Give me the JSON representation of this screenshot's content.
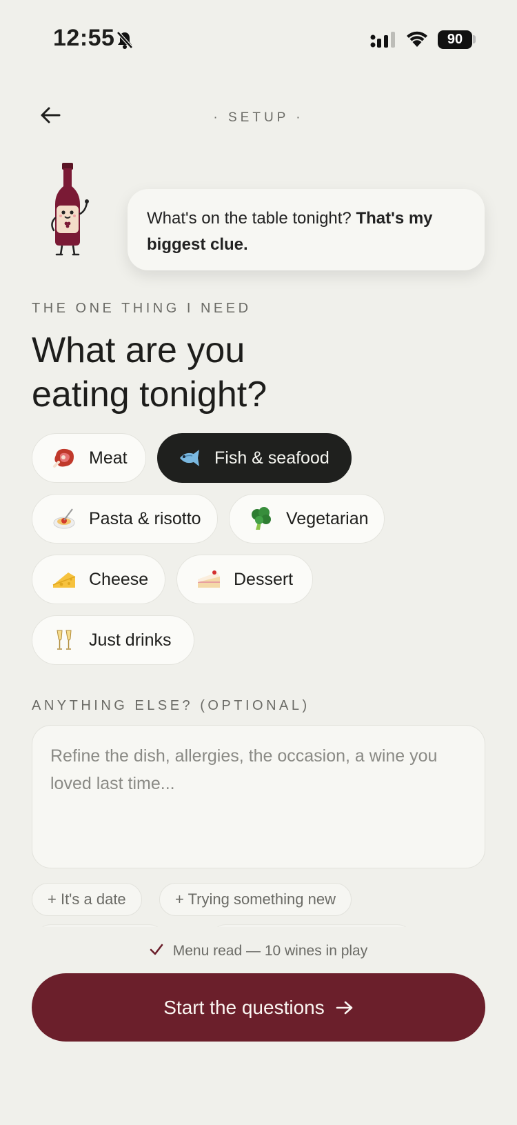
{
  "status_bar": {
    "time": "12:55",
    "battery": "90",
    "icons": [
      "bell-slash-icon",
      "signal-icon",
      "wifi-icon",
      "battery-icon"
    ]
  },
  "header": {
    "back_icon": "arrow-left-icon",
    "title": "· SETUP ·"
  },
  "mascot": {
    "icon": "wine-bottle-mascot",
    "bubble_text": "What's on the table tonight?",
    "bubble_bold": "That's my biggest clue."
  },
  "question": {
    "eyebrow": "THE ONE THING I NEED",
    "line1": "What are you",
    "line2": "eating tonight?"
  },
  "food_options": [
    {
      "label": "Meat",
      "icon": "steak-emoji",
      "selected": false
    },
    {
      "label": "Fish & seafood",
      "icon": "fish-emoji",
      "selected": true
    },
    {
      "label": "Pasta & risotto",
      "icon": "spaghetti-emoji",
      "selected": false
    },
    {
      "label": "Vegetarian",
      "icon": "broccoli-emoji",
      "selected": false
    },
    {
      "label": "Cheese",
      "icon": "cheese-emoji",
      "selected": false
    },
    {
      "label": "Dessert",
      "icon": "cake-emoji",
      "selected": false
    },
    {
      "label": "Just drinks",
      "icon": "champagne-emoji",
      "selected": false
    }
  ],
  "optional": {
    "label": "ANYTHING ELSE? (OPTIONAL)",
    "value": "",
    "placeholder": "Refine the dish, allergies, the occasion, a wine you loved last time..."
  },
  "suggestions": [
    "+ It's a date",
    "+ Trying something new"
  ],
  "menu_status": {
    "icon": "check-icon",
    "text": "Menu read — 10 wines in play"
  },
  "cta": {
    "label": "Start the questions",
    "icon": "arrow-right-icon"
  },
  "colors": {
    "background": "#f0f0eb",
    "accent": "#6b1f2b",
    "chip_selected": "#1f201e",
    "muted_text": "#6b6b66"
  }
}
